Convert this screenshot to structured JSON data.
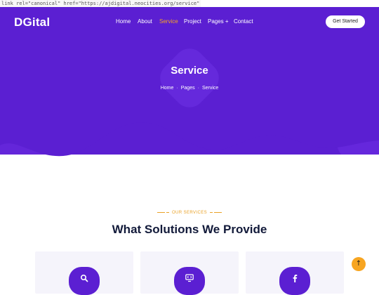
{
  "source_leak": "link rel=\"canonical\" href=\"https://ajdigital.neocities.org/service\"",
  "header": {
    "logo": "DGital",
    "nav": [
      {
        "label": "Home"
      },
      {
        "label": "About"
      },
      {
        "label": "Service",
        "active": true
      },
      {
        "label": "Project"
      },
      {
        "label": "Pages +"
      },
      {
        "label": "Contact"
      }
    ],
    "cta_label": "Get Started"
  },
  "hero": {
    "title": "Service",
    "breadcrumb": [
      "Home",
      "Pages",
      "Service"
    ],
    "background": "#5b1fd2"
  },
  "services": {
    "eyebrow": "OUR SERVICES",
    "title": "What Solutions We Provide",
    "cards": [
      {
        "icon": "search-icon"
      },
      {
        "icon": "monitor-code-icon"
      },
      {
        "icon": "facebook-icon"
      }
    ]
  },
  "scroll_top": {
    "icon": "arrow-up-icon"
  },
  "colors": {
    "primary": "#5b1fd2",
    "accent": "#f7a521",
    "heading": "#121a3a"
  }
}
